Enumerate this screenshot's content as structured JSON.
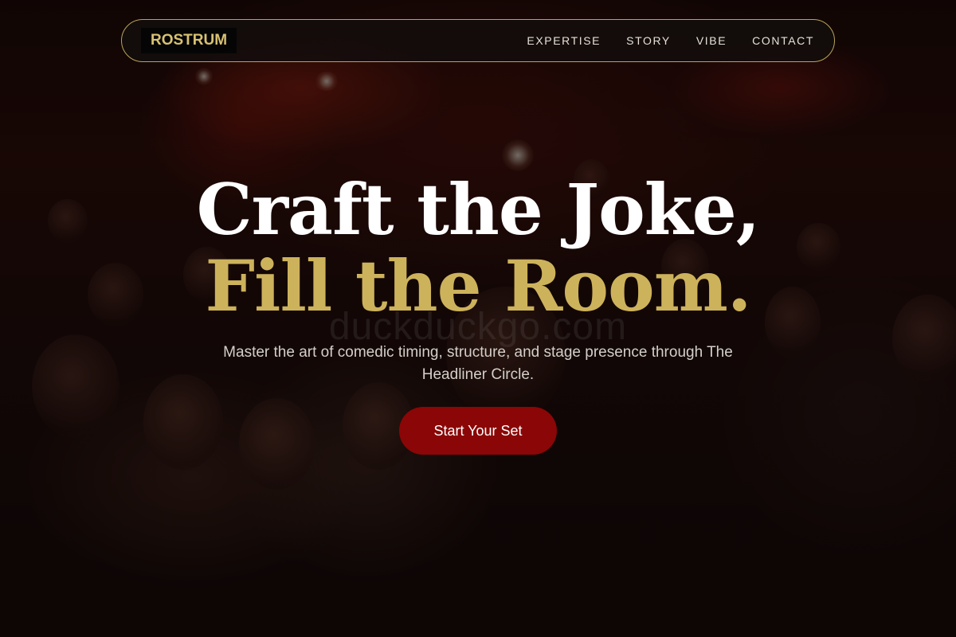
{
  "nav": {
    "brand": "ROSTRUM",
    "links": [
      "EXPERTISE",
      "STORY",
      "VIBE",
      "CONTACT"
    ]
  },
  "hero": {
    "headline_line1": "Craft the Joke,",
    "headline_line2": "Fill the Room.",
    "subtitle": "Master the art of comedic timing, structure, and stage presence through The Headliner Circle.",
    "cta_label": "Start Your Set",
    "watermark": "duckduckgo.com"
  },
  "colors": {
    "accent_gold": "#cdb25c",
    "nav_border": "#b9a35a",
    "cta_red": "#8b0606"
  }
}
